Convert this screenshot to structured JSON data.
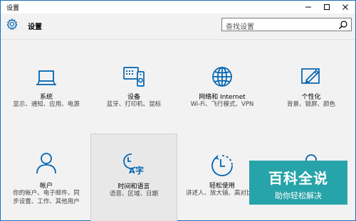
{
  "window": {
    "title": "设置"
  },
  "header": {
    "title": "设置",
    "search_placeholder": "查找设置"
  },
  "tiles": [
    {
      "name": "系统",
      "desc": "显示、通知、应用、电源",
      "icon": "laptop-icon"
    },
    {
      "name": "设备",
      "desc": "蓝牙、打印机、鼠标",
      "icon": "devices-icon"
    },
    {
      "name": "网络和 Internet",
      "desc": "Wi-Fi、飞行模式、VPN",
      "icon": "globe-icon"
    },
    {
      "name": "个性化",
      "desc": "背景、锁屏、颜色",
      "icon": "paint-icon"
    },
    {
      "name": "帐户",
      "desc": "你的帐户、电子邮件、同步设置、工作、其他用户",
      "icon": "person-icon"
    },
    {
      "name": "时间和语言",
      "desc": "语音、区域、日期",
      "icon": "time-language-icon"
    },
    {
      "name": "轻松使用",
      "desc": "讲述人、放大镜、高对比度",
      "icon": "ease-of-access-icon"
    }
  ],
  "watermark": {
    "big": "百科全说",
    "small": "助你轻松解决"
  },
  "colors": {
    "accent": "#0063b1",
    "watermark": "#27a4a9"
  }
}
